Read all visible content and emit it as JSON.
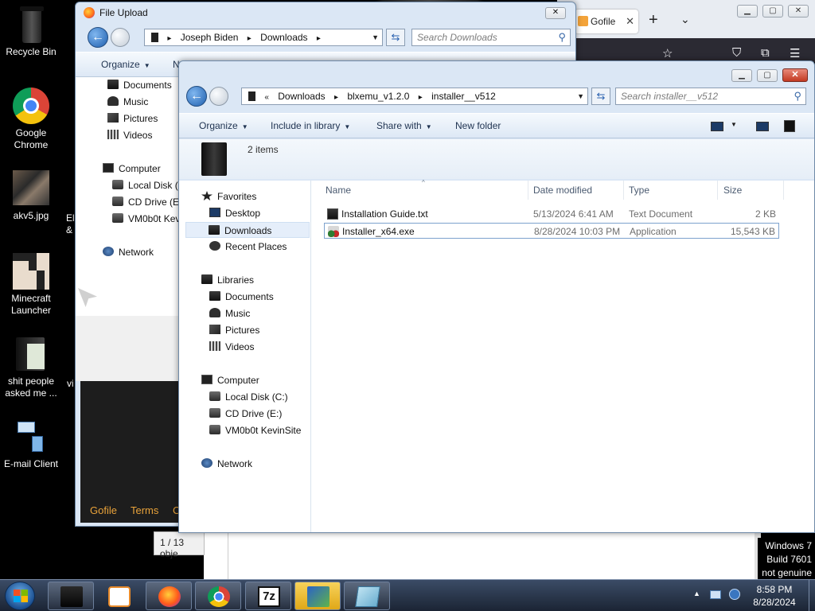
{
  "desktop": {
    "icons": [
      {
        "label": "Recycle Bin"
      },
      {
        "label": "Google Chrome"
      },
      {
        "label": "akv5.jpg"
      },
      {
        "label": "Minecraft Launcher"
      },
      {
        "label": "shit people asked me ..."
      },
      {
        "label": "E-mail Client"
      }
    ],
    "fragments": [
      "El",
      "&",
      "vi"
    ]
  },
  "firefox": {
    "tab_title": "Gofile",
    "footer_links": [
      "Gofile",
      "Terms",
      "C"
    ],
    "status_text": "1 / 13 obje"
  },
  "upload_dialog": {
    "title": "File Upload",
    "path": [
      "Joseph Biden",
      "Downloads"
    ],
    "search_placeholder": "Search Downloads",
    "toolbar": {
      "organize": "Organize",
      "next": "N"
    },
    "nav_items": [
      "Documents",
      "Music",
      "Pictures",
      "Videos",
      "Computer",
      "Local Disk (C",
      "CD Drive (E:",
      "VM0b0t Kev",
      "Network"
    ]
  },
  "explorer": {
    "path": [
      "Downloads",
      "blxemu_v1.2.0",
      "installer__v512"
    ],
    "search_placeholder": "Search installer__v512",
    "toolbar": {
      "organize": "Organize",
      "include_in_library": "Include in library",
      "share_with": "Share with",
      "new_folder": "New folder"
    },
    "details": {
      "item_count": "2 items"
    },
    "nav": {
      "favorites": {
        "label": "Favorites",
        "items": [
          "Desktop",
          "Downloads",
          "Recent Places"
        ]
      },
      "libraries": {
        "label": "Libraries",
        "items": [
          "Documents",
          "Music",
          "Pictures",
          "Videos"
        ]
      },
      "computer": {
        "label": "Computer",
        "items": [
          "Local Disk (C:)",
          "CD Drive (E:)",
          "VM0b0t KevinSite"
        ]
      },
      "network": {
        "label": "Network"
      }
    },
    "columns": {
      "name": "Name",
      "date": "Date modified",
      "type": "Type",
      "size": "Size"
    },
    "files": [
      {
        "name": "Installation Guide.txt",
        "date": "5/13/2024 6:41 AM",
        "type": "Text Document",
        "size": "2 KB"
      },
      {
        "name": "Installer_x64.exe",
        "date": "8/28/2024 10:03 PM",
        "type": "Application",
        "size": "15,543 KB"
      }
    ]
  },
  "taskbar": {
    "apps": [
      "explorer",
      "media-player",
      "firefox",
      "chrome",
      "7zip",
      "notepad-app",
      "tablet-app"
    ],
    "clock": {
      "time": "8:58 PM",
      "date": "8/28/2024"
    }
  },
  "watermark": {
    "line1": "Windows 7",
    "line2": "Build 7601",
    "line3": "not genuine"
  }
}
